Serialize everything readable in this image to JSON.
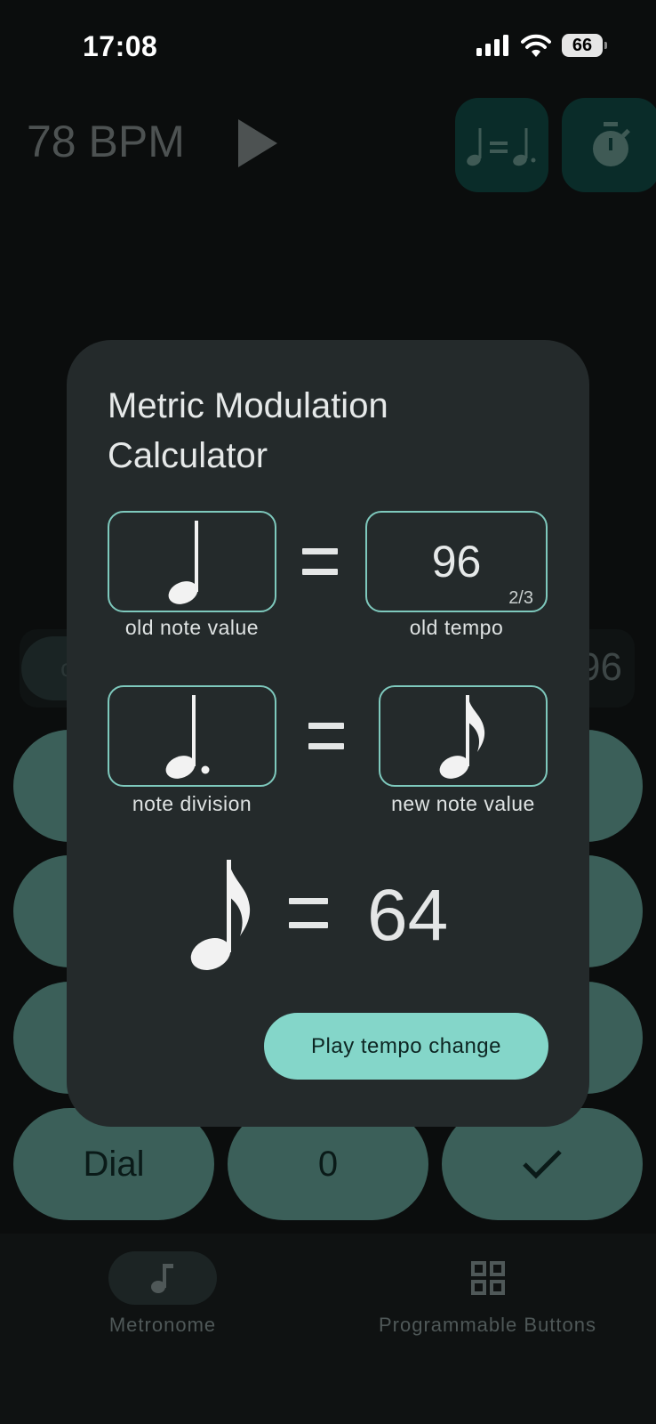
{
  "status": {
    "time": "17:08",
    "battery": "66"
  },
  "header": {
    "bpm": "78 BPM",
    "play_icon": "play-icon",
    "modulation_icon": "metric-modulation-icon",
    "timer_icon": "stopwatch-icon"
  },
  "background": {
    "tempo_partial": "96",
    "chip_partial": "c"
  },
  "keypad": {
    "keys": [
      "Dial",
      "0",
      "✓"
    ]
  },
  "dialog": {
    "title": "Metric Modulation Calculator",
    "old_note_label": "old note value",
    "old_tempo_value": "96",
    "old_tempo_page": "2/3",
    "old_tempo_label": "old tempo",
    "note_division_label": "note division",
    "new_note_label": "new note value",
    "result_value": "64",
    "play_button": "Play tempo change"
  },
  "nav": {
    "items": [
      {
        "label": "Metronome",
        "icon": "music-note-icon",
        "selected": true
      },
      {
        "label": "Programmable Buttons",
        "icon": "grid-icon",
        "selected": false
      }
    ]
  },
  "colors": {
    "accent": "#84d6c9",
    "dialog_bg": "#242a2b",
    "key_bg": "#3b5f59",
    "field_border": "#7ec9bd"
  }
}
